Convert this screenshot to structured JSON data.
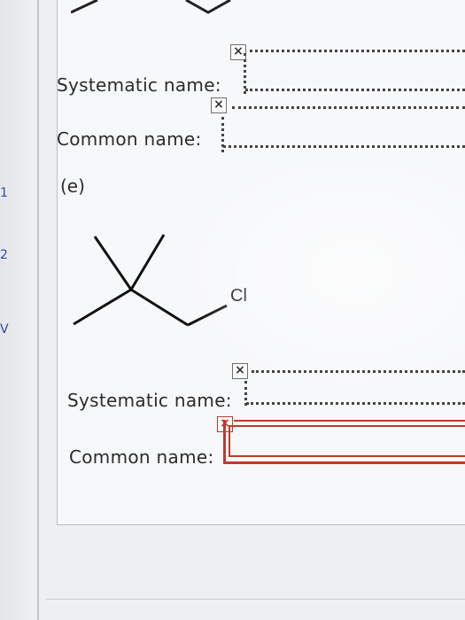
{
  "margin": {
    "marks": [
      "1",
      "2",
      "V"
    ]
  },
  "question_d": {
    "systematic_label": "Systematic name:",
    "common_label": "Common name:",
    "systematic_value": "",
    "common_value": ""
  },
  "question_e": {
    "part_label": "(e)",
    "molecule_substituent_label": "Cl",
    "systematic_label": "Systematic name:",
    "common_label": "Common name:",
    "systematic_value": "",
    "common_value": ""
  },
  "icons": {
    "broken_image": "x-box-icon"
  },
  "colors": {
    "error_red": "#c0392b",
    "text": "#2b2b2b",
    "panel_bg": "#f7f8fa"
  }
}
